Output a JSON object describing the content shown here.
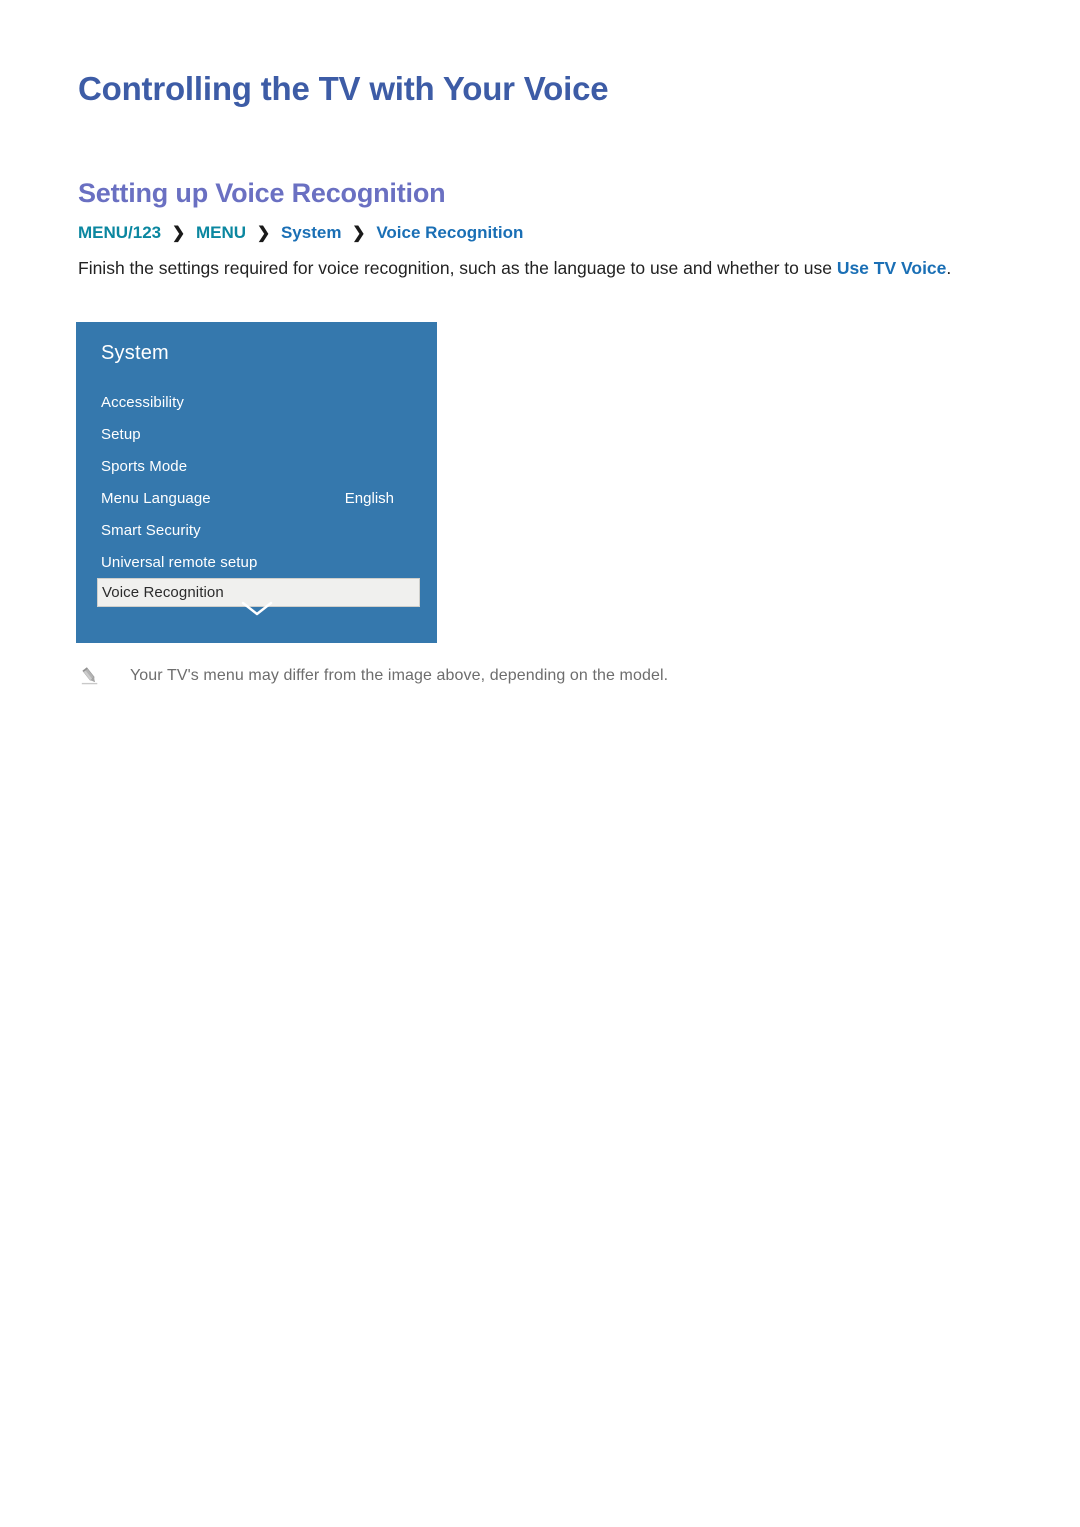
{
  "document": {
    "title": "Controlling the TV with Your Voice",
    "section_title": "Setting up Voice Recognition"
  },
  "breadcrumb": {
    "separator": "❯",
    "items": [
      {
        "label": "MENU/123",
        "style": "teal"
      },
      {
        "label": "MENU",
        "style": "teal"
      },
      {
        "label": "System",
        "style": "blue"
      },
      {
        "label": "Voice Recognition",
        "style": "blue"
      }
    ]
  },
  "paragraph": {
    "text_before_link": "Finish the settings required for voice recognition, such as the language to use and whether to use ",
    "link_text": "Use TV Voice",
    "text_after_link": "."
  },
  "tv_menu": {
    "panel_title": "System",
    "items": [
      {
        "label": "Accessibility",
        "value": "",
        "selected": false
      },
      {
        "label": "Setup",
        "value": "",
        "selected": false
      },
      {
        "label": "Sports Mode",
        "value": "",
        "selected": false
      },
      {
        "label": "Menu Language",
        "value": "English",
        "selected": false
      },
      {
        "label": "Smart Security",
        "value": "",
        "selected": false
      },
      {
        "label": "Universal remote setup",
        "value": "",
        "selected": false
      },
      {
        "label": "Voice Recognition",
        "value": "",
        "selected": true
      }
    ],
    "scroll_icon": "chevron-down-icon"
  },
  "note": {
    "icon": "pencil-icon",
    "text": "Your TV's menu may differ from the image above, depending on the model."
  },
  "colors": {
    "page_title": "#3d5ca6",
    "section_title": "#6a70c2",
    "crumb_teal": "#0b87a0",
    "crumb_blue": "#1a6fb5",
    "link_blue": "#1a6fb5",
    "panel_bg": "#3578ad",
    "selected_row_bg": "#f0f0ee",
    "note_text": "#6d6d6d"
  }
}
